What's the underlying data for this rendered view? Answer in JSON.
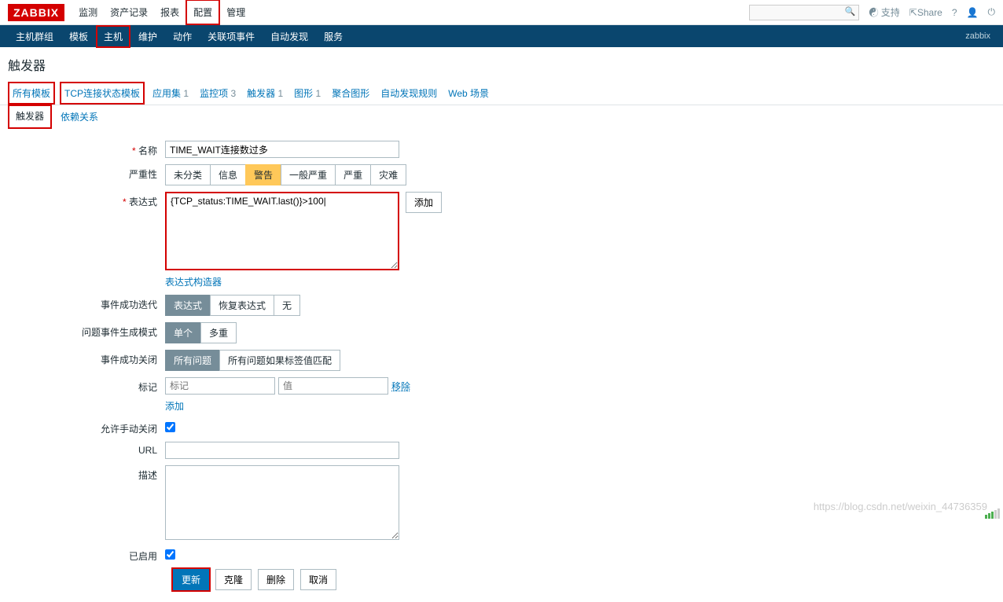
{
  "logo": "ZABBIX",
  "top_menu": [
    "监测",
    "资产记录",
    "报表",
    "配置",
    "管理"
  ],
  "top_right": {
    "support": "☯ 支持",
    "share": "⇱Share",
    "help": "?",
    "user": "👤",
    "logout": "⏻"
  },
  "sub_menu": [
    "主机群组",
    "模板",
    "主机",
    "维护",
    "动作",
    "关联项事件",
    "自动发现",
    "服务"
  ],
  "sub_right": "zabbix",
  "page_title": "触发器",
  "nav_tabs": [
    {
      "label": "所有模板",
      "count": ""
    },
    {
      "label": "TCP连接状态模板",
      "count": ""
    },
    {
      "label": "应用集",
      "count": "1"
    },
    {
      "label": "监控项",
      "count": "3"
    },
    {
      "label": "触发器",
      "count": "1"
    },
    {
      "label": "图形",
      "count": "1"
    },
    {
      "label": "聚合图形",
      "count": ""
    },
    {
      "label": "自动发现规则",
      "count": ""
    },
    {
      "label": "Web 场景",
      "count": ""
    }
  ],
  "inner_tabs": [
    "触发器",
    "依赖关系"
  ],
  "labels": {
    "name": "名称",
    "severity": "严重性",
    "expr": "表达式",
    "expr_builder": "表达式构造器",
    "ok_gen": "事件成功迭代",
    "prob_mode": "问题事件生成模式",
    "ok_close": "事件成功关闭",
    "tags": "标记",
    "manual_close": "允许手动关闭",
    "url": "URL",
    "desc": "描述",
    "enabled": "已启用",
    "add_btn": "添加",
    "remove": "移除",
    "add_link": "添加"
  },
  "values": {
    "name": "TIME_WAIT连接数过多",
    "expr": "{TCP_status:TIME_WAIT.last()}>100|",
    "tag_ph": "标记",
    "val_ph": "值"
  },
  "severity_opts": [
    "未分类",
    "信息",
    "警告",
    "一般严重",
    "严重",
    "灾难"
  ],
  "ok_gen_opts": [
    "表达式",
    "恢复表达式",
    "无"
  ],
  "prob_mode_opts": [
    "单个",
    "多重"
  ],
  "ok_close_opts": [
    "所有问题",
    "所有问题如果标签值匹配"
  ],
  "actions": {
    "update": "更新",
    "clone": "克隆",
    "delete": "删除",
    "cancel": "取消"
  },
  "watermark": "https://blog.csdn.net/weixin_44736359"
}
